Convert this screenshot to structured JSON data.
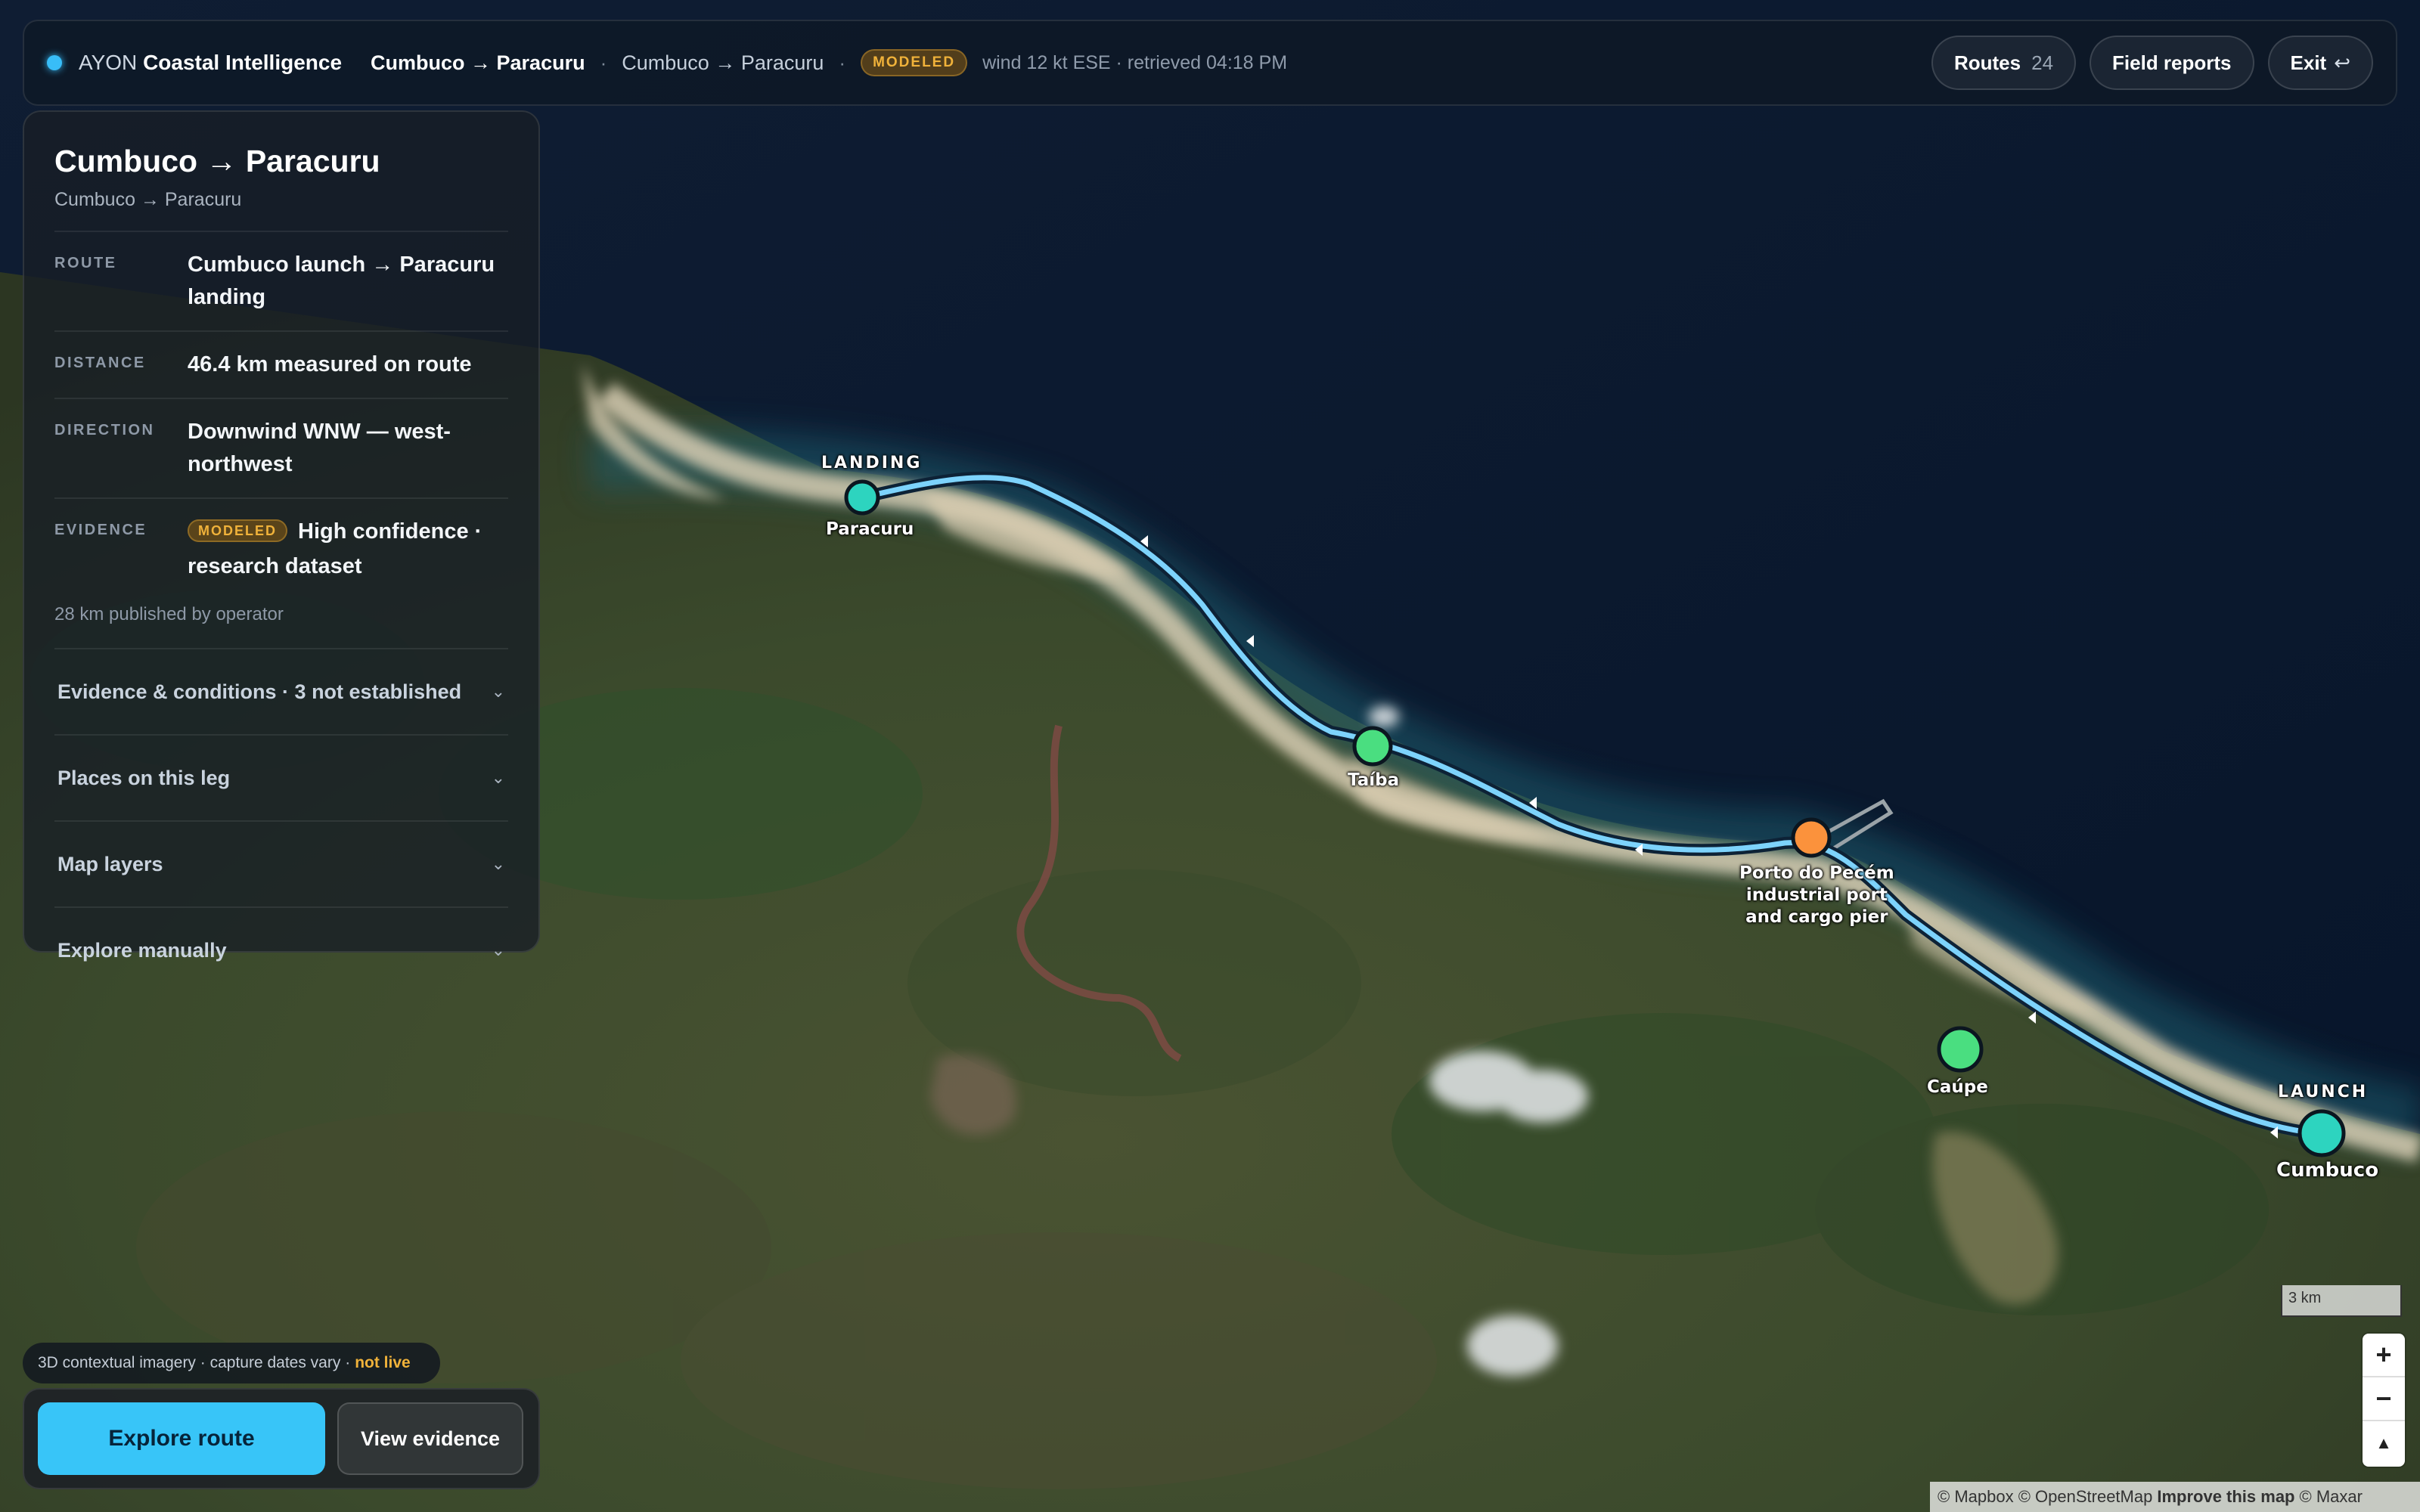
{
  "topbar": {
    "brand_prefix": "AYON",
    "brand_name": "Coastal Intelligence",
    "route_title": "Cumbuco → Paracuru",
    "separator": "·",
    "route_subtitle": "Cumbuco → Paracuru",
    "evidence_badge": "MODELED",
    "conditions": "wind 12 kt ESE · retrieved 04:18 PM",
    "routes_label": "Routes",
    "routes_count": "24",
    "field_reports_label": "Field reports",
    "exit_label": "Exit",
    "exit_icon": "↩"
  },
  "panel": {
    "title": "Cumbuco → Paracuru",
    "subtitle": "Cumbuco → Paracuru",
    "rows": [
      {
        "key": "ROUTE",
        "value": "Cumbuco launch → Paracuru landing"
      },
      {
        "key": "DISTANCE",
        "value": "46.4 km measured on route"
      },
      {
        "key": "DIRECTION",
        "value": "Downwind WNW — west-northwest"
      },
      {
        "key": "EVIDENCE",
        "badge": "MODELED",
        "value": "High confidence · research dataset"
      }
    ],
    "note": "28 km published by operator",
    "sections": [
      {
        "label": "Evidence & conditions · 3 not established",
        "chevron": "⌄"
      },
      {
        "label": "Places on this leg",
        "chevron": "⌄"
      },
      {
        "label": "Map layers",
        "chevron": "⌄"
      },
      {
        "label": "Explore manually",
        "chevron": "⌄"
      }
    ]
  },
  "imagery_note": {
    "text": "3D contextual imagery · capture dates vary ·",
    "status": "not live"
  },
  "actions": {
    "primary": "Explore route",
    "secondary": "View evidence"
  },
  "map": {
    "markers": [
      {
        "name": "Paracuru",
        "tag": "LANDING",
        "color": "#2dd4bf"
      },
      {
        "name": "Taíba",
        "color": "#4ade80"
      },
      {
        "name": "Porto do Pecém industrial port and cargo pier",
        "lines": [
          "Porto do Pecém",
          "industrial port",
          "and cargo pier"
        ],
        "color": "#fb923c"
      },
      {
        "name": "Caúpe",
        "color": "#4ade80"
      },
      {
        "name": "Cumbuco",
        "tag": "LAUNCH",
        "color": "#2dd4bf"
      }
    ],
    "route_color": "#7dd3fc",
    "scale_label": "3 km",
    "zoom_in": "+",
    "zoom_out": "−",
    "compass": "▲",
    "attribution_1": "© Mapbox © OpenStreetMap",
    "attribution_2": "Improve this map",
    "attribution_3": "© Maxar"
  },
  "colors": {
    "accent": "#38c5f8",
    "modeled": "#f0b23a",
    "ocean": "#0b1a2e",
    "land": "#3e4a2f"
  }
}
